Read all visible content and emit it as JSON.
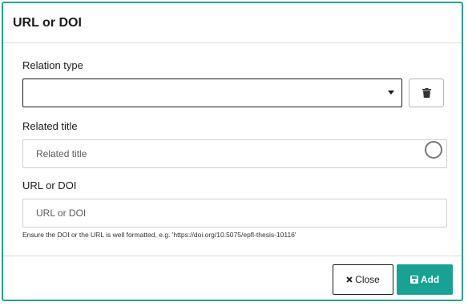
{
  "dialog": {
    "title": "URL or DOI"
  },
  "relation_type": {
    "label": "Relation type",
    "selected_value": ""
  },
  "related_title": {
    "label": "Related title",
    "placeholder": "Related title",
    "value": ""
  },
  "url_or_doi": {
    "label": "URL or DOI",
    "placeholder": "URL or DOI",
    "value": "",
    "help_text": "Ensure the DOI or the URL is well formatted, e.g. 'https://doi.org/10.5075/epfl-thesis-10116'"
  },
  "footer": {
    "close_label": "Close",
    "add_label": "Add"
  },
  "icons": {
    "delete": "trash-icon",
    "loading": "spinner-icon",
    "close": "times-icon",
    "add": "save-icon",
    "dropdown": "caret-down-icon"
  },
  "colors": {
    "accent": "#17a293",
    "border_accent": "#2aa18f"
  }
}
